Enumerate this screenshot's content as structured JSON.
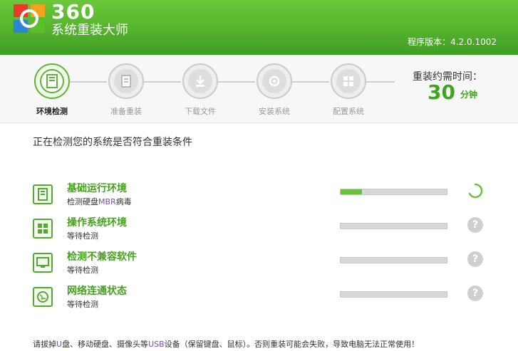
{
  "app": {
    "logo_number": "360",
    "logo_name": "系统重装大师",
    "version_label": "程序版本：4.2.0.1002"
  },
  "steps": [
    {
      "label": "环境检测",
      "icon": "pc-tower-icon",
      "active": true
    },
    {
      "label": "准备重装",
      "icon": "document-icon",
      "active": false
    },
    {
      "label": "下载文件",
      "icon": "download-icon",
      "active": false
    },
    {
      "label": "安装系统",
      "icon": "install-icon",
      "active": false
    },
    {
      "label": "配置系统",
      "icon": "windows-icon",
      "active": false
    }
  ],
  "time": {
    "title": "重装约需时间：",
    "value": "30",
    "unit": "分钟"
  },
  "main_title": "正在检测您的系统是否符合重装条件",
  "checks": [
    {
      "title": "基础运行环境",
      "sub_a": "检测硬盘",
      "sub_hl": "MBR",
      "sub_b": "病毒",
      "icon": "pc-tower-icon",
      "progress": 0.2,
      "status": "loading"
    },
    {
      "title": "操作系统环境",
      "sub_a": "等待检测",
      "sub_hl": "",
      "sub_b": "",
      "icon": "windows-icon",
      "progress": 0,
      "status": "pending"
    },
    {
      "title": "检测不兼容软件",
      "sub_a": "等待检测",
      "sub_hl": "",
      "sub_b": "",
      "icon": "monitor-icon",
      "progress": 0,
      "status": "pending"
    },
    {
      "title": "网络连通状态",
      "sub_a": "等待检测",
      "sub_hl": "",
      "sub_b": "",
      "icon": "globe-icon",
      "progress": 0,
      "status": "pending"
    }
  ],
  "pending_mark": "?",
  "footer": {
    "part1": "请拔掉",
    "hl1": "U",
    "part2": "盘、移动硬盘、摄像头等",
    "hl2": "USB",
    "part3": "设备（保留键盘、鼠标）。否则重装可能会失败，导致电脑无法正常使用！"
  },
  "colors": {
    "header_green": "#4fb12b",
    "accent_green": "#3ea61d",
    "highlight_purple": "#7c4fb0"
  }
}
